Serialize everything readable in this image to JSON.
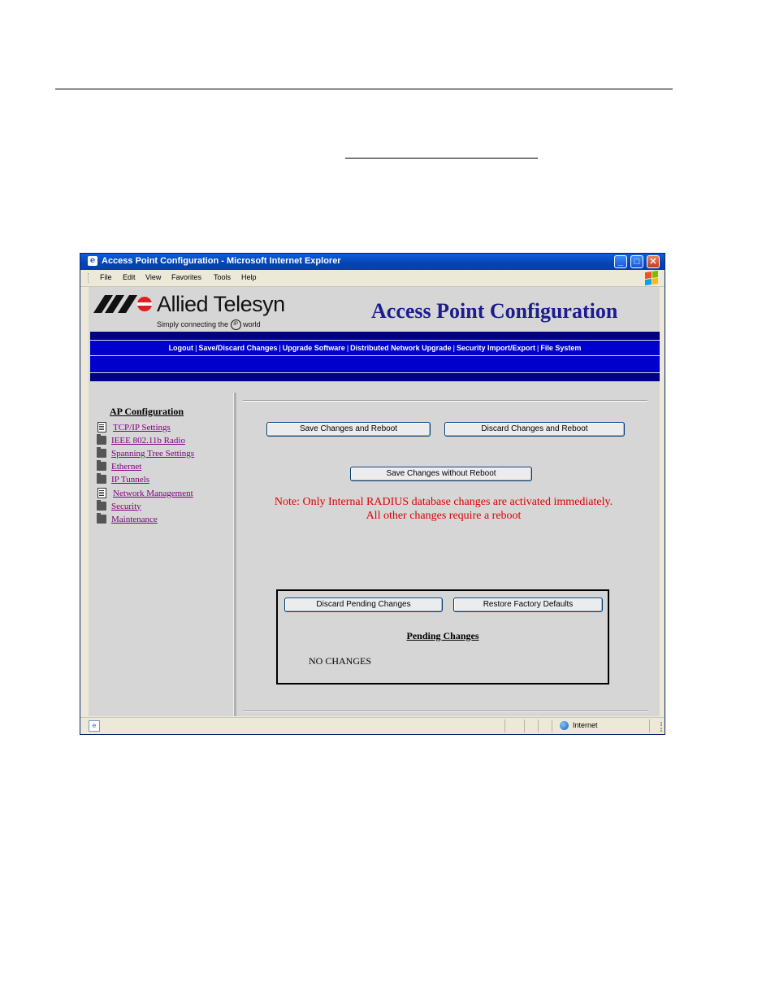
{
  "window": {
    "title": "Access Point Configuration - Microsoft Internet Explorer",
    "controls": {
      "minimize": "_",
      "maximize": "□",
      "close": "✕"
    }
  },
  "menu": [
    "File",
    "Edit",
    "View",
    "Favorites",
    "Tools",
    "Help"
  ],
  "header": {
    "brand_name": "Allied Telesyn",
    "tagline_pre": "Simply connecting the",
    "tagline_ip": "IP",
    "tagline_post": "world",
    "page_title": "Access Point Configuration"
  },
  "nav": [
    "Logout",
    "Save/Discard Changes",
    "Upgrade Software",
    "Distributed Network Upgrade",
    "Security Import/Export",
    "File System"
  ],
  "sidebar": {
    "heading": "AP Configuration",
    "items": [
      {
        "label": "TCP/IP Settings",
        "icon": "document-icon"
      },
      {
        "label": "IEEE 802.11b Radio",
        "icon": "folder-icon"
      },
      {
        "label": "Spanning Tree Settings",
        "icon": "folder-icon"
      },
      {
        "label": "Ethernet",
        "icon": "folder-icon"
      },
      {
        "label": "IP Tunnels",
        "icon": "folder-icon"
      },
      {
        "label": "Network Management",
        "icon": "document-icon"
      },
      {
        "label": "Security",
        "icon": "folder-icon"
      },
      {
        "label": "Maintenance",
        "icon": "folder-icon"
      }
    ]
  },
  "actions": {
    "save_reboot": "Save Changes and Reboot",
    "discard_reboot": "Discard Changes and Reboot",
    "save_no_reboot": "Save Changes without Reboot"
  },
  "note": {
    "line1": "Note: Only Internal RADIUS database changes are activated immediately.",
    "line2": "All other changes require a reboot"
  },
  "pending": {
    "discard_button": "Discard Pending Changes",
    "restore_button": "Restore Factory Defaults",
    "title": "Pending Changes",
    "value": "NO CHANGES"
  },
  "status": {
    "zone": "Internet"
  },
  "colors": {
    "nav_bar": "#0000cc",
    "nav_band_dark": "#000080",
    "page_title": "#1c1c8c",
    "note_text": "#e00000",
    "visited_link": "#800080"
  }
}
